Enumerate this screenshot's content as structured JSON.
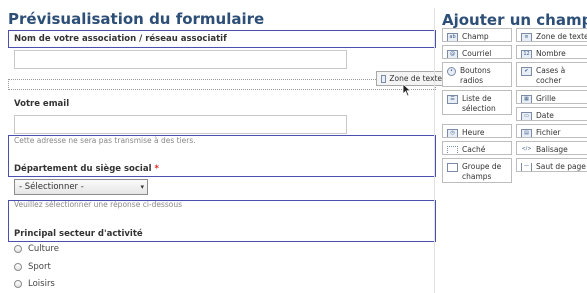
{
  "preview": {
    "title": "Prévisualisation du formulaire",
    "fields": {
      "association": {
        "label": "Nom de votre association / réseau associatif",
        "value": ""
      },
      "email": {
        "label": "Votre email",
        "value": "",
        "help": "Cette adresse ne sera pas transmise à des tiers."
      },
      "department": {
        "label": "Département du siège social",
        "required_mark": "*",
        "selected": "- Sélectionner -",
        "help": "Veuillez sélectionner une réponse ci-dessous"
      },
      "sector": {
        "label": "Principal secteur d'activité",
        "options": [
          "Culture",
          "Sport",
          "Loisirs"
        ]
      }
    },
    "drag_ghost": {
      "label": "Zone de texte",
      "icon": "textarea-icon"
    }
  },
  "toolbox": {
    "title": "Ajouter un champ",
    "tools": [
      {
        "label": "Champ texte",
        "icon": "textfield-icon"
      },
      {
        "label": "Zone de texte",
        "icon": "textarea-icon"
      },
      {
        "label": "Courriel",
        "icon": "email-icon"
      },
      {
        "label": "Nombre",
        "icon": "number-icon"
      },
      {
        "label": "Boutons radios",
        "icon": "radio-icon"
      },
      {
        "label": "Cases à cocher",
        "icon": "checkbox-icon"
      },
      {
        "label": "Liste de sélection",
        "icon": "select-list-icon"
      },
      {
        "label": "Grille",
        "icon": "grid-icon"
      },
      {
        "label": "Date",
        "icon": "date-icon"
      },
      {
        "label": "Heure",
        "icon": "time-icon"
      },
      {
        "label": "Fichier",
        "icon": "file-icon"
      },
      {
        "label": "Caché",
        "icon": "hidden-icon"
      },
      {
        "label": "Balisage",
        "icon": "markup-icon"
      },
      {
        "label": "Groupe de champs",
        "icon": "fieldset-icon"
      },
      {
        "label": "Saut de page",
        "icon": "pagebreak-icon"
      }
    ]
  },
  "colors": {
    "title": "#2d4e76",
    "field_border": "#4a4fb0",
    "required": "#dd2222"
  }
}
